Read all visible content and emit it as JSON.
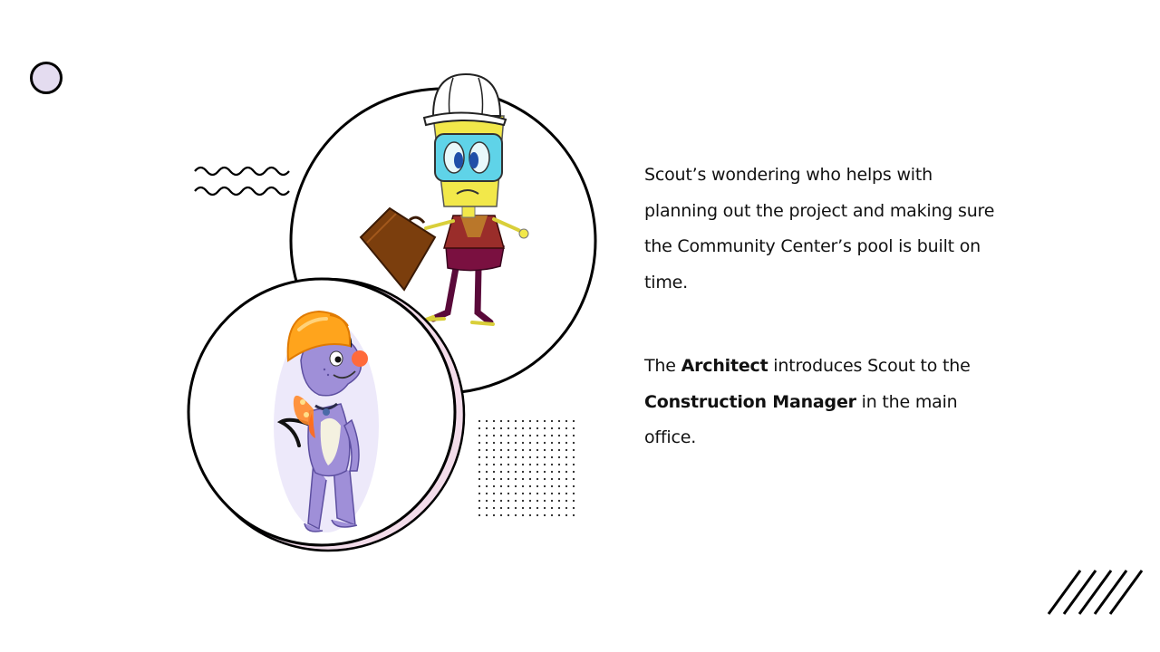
{
  "paragraph1": "Scout’s  wondering who helps with planning out the project and making sure the Community Center’s pool is built on time.",
  "paragraph2": {
    "part1": "The ",
    "bold1": "Architect",
    "part2": " introduces Scout to the ",
    "bold2": "Construction Manager",
    "part3": " in the main office."
  },
  "colors": {
    "accent_lavender": "#e4dcf0",
    "pink_shadow": "#f3dcea",
    "outline": "#000000",
    "dog_purple": "#9f8fd8",
    "hardhat_orange": "#ffa41c",
    "robot_yellow": "#f2e84a",
    "robot_screen": "#5fd3e8",
    "briefcase_brown": "#7b3e0d"
  },
  "icons": {
    "small_circle": "circle-outline-icon",
    "wave": "wave-lines-icon",
    "dots": "dot-grid-icon",
    "slashes": "diagonal-slashes-icon"
  }
}
